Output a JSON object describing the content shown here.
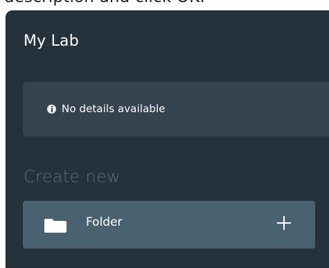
{
  "caption": "description and click OK.",
  "panel": {
    "title": "My Lab",
    "details": {
      "icon": "info-icon",
      "message": "No details available"
    },
    "create_section": {
      "label": "Create new",
      "items": [
        {
          "icon": "folder-icon",
          "label": "Folder",
          "action_icon": "plus-icon"
        }
      ]
    }
  },
  "colors": {
    "panel_bg": "#25323c",
    "details_bg": "#34434f",
    "item_bg": "#4a6170",
    "muted_text": "#5c6b76",
    "text": "#ffffff"
  }
}
